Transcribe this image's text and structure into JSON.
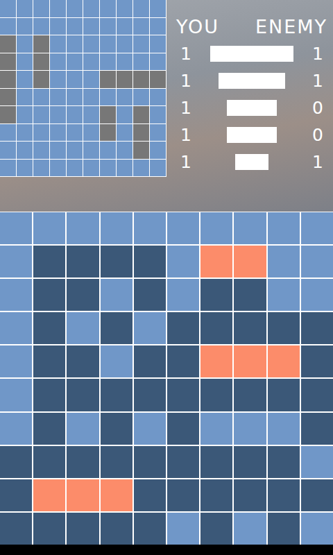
{
  "scoreboard": {
    "you_label": "YOU",
    "enemy_label": "ENEMY",
    "ships": [
      {
        "length": 5,
        "you": "1",
        "enemy": "1"
      },
      {
        "length": 4,
        "you": "1",
        "enemy": "1"
      },
      {
        "length": 3,
        "you": "1",
        "enemy": "0"
      },
      {
        "length": 3,
        "you": "1",
        "enemy": "0"
      },
      {
        "length": 2,
        "you": "1",
        "enemy": "1"
      }
    ]
  },
  "own_board": {
    "rows": [
      [
        false,
        false,
        false,
        false,
        false,
        false,
        false,
        false,
        false,
        false
      ],
      [
        false,
        false,
        false,
        false,
        false,
        false,
        false,
        false,
        false,
        false
      ],
      [
        true,
        false,
        true,
        false,
        false,
        false,
        false,
        false,
        false,
        false
      ],
      [
        true,
        false,
        true,
        false,
        false,
        false,
        false,
        false,
        false,
        false
      ],
      [
        true,
        false,
        true,
        false,
        false,
        false,
        true,
        true,
        true,
        true
      ],
      [
        true,
        false,
        false,
        false,
        false,
        false,
        false,
        false,
        false,
        false
      ],
      [
        true,
        false,
        false,
        false,
        false,
        false,
        true,
        false,
        true,
        false
      ],
      [
        false,
        false,
        false,
        false,
        false,
        false,
        true,
        false,
        true,
        false
      ],
      [
        false,
        false,
        false,
        false,
        false,
        false,
        false,
        false,
        true,
        false
      ],
      [
        false,
        false,
        false,
        false,
        false,
        false,
        false,
        false,
        false,
        false
      ]
    ]
  },
  "target_board": {
    "rows": [
      [
        "unknown",
        "unknown",
        "unknown",
        "unknown",
        "unknown",
        "unknown",
        "unknown",
        "unknown",
        "unknown",
        "unknown"
      ],
      [
        "unknown",
        "miss",
        "miss",
        "miss",
        "miss",
        "unknown",
        "hit",
        "hit",
        "unknown",
        "unknown"
      ],
      [
        "unknown",
        "miss",
        "miss",
        "unknown",
        "miss",
        "unknown",
        "miss",
        "miss",
        "unknown",
        "unknown"
      ],
      [
        "unknown",
        "miss",
        "unknown",
        "miss",
        "unknown",
        "miss",
        "miss",
        "miss",
        "miss",
        "miss"
      ],
      [
        "unknown",
        "miss",
        "miss",
        "unknown",
        "miss",
        "miss",
        "hit",
        "hit",
        "hit",
        "miss"
      ],
      [
        "unknown",
        "miss",
        "miss",
        "miss",
        "miss",
        "miss",
        "miss",
        "miss",
        "miss",
        "miss"
      ],
      [
        "unknown",
        "miss",
        "unknown",
        "miss",
        "unknown",
        "miss",
        "unknown",
        "unknown",
        "unknown",
        "miss"
      ],
      [
        "miss",
        "miss",
        "miss",
        "miss",
        "miss",
        "miss",
        "miss",
        "miss",
        "miss",
        "unknown"
      ],
      [
        "miss",
        "hit",
        "hit",
        "hit",
        "miss",
        "miss",
        "miss",
        "miss",
        "miss",
        "miss"
      ],
      [
        "miss",
        "miss",
        "miss",
        "miss",
        "miss",
        "unknown",
        "miss",
        "unknown",
        "miss",
        "unknown"
      ]
    ]
  }
}
